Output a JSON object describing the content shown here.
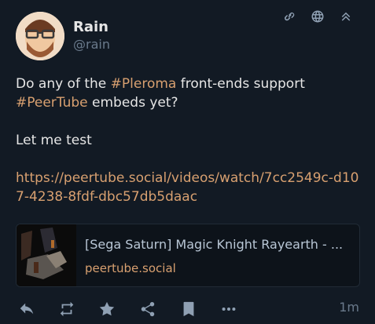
{
  "author": {
    "name": "Rain",
    "handle": "@rain"
  },
  "content": {
    "line1_prefix": "Do any of the ",
    "hashtag1": "#Pleroma",
    "line1_suffix": " front-ends support",
    "hashtag2": "#PeerTube",
    "line2_suffix": " embeds yet?",
    "paragraph2": "Let me test",
    "link": "https://peertube.social/videos/watch/7cc2549c-d107-4238-8fdf-dbc57db5daac"
  },
  "card": {
    "title": "[Sega Saturn] Magic Knight Rayearth - ...",
    "host": "peertube.social"
  },
  "timestamp": "1m",
  "colors": {
    "accent": "#d8a070",
    "background": "#121a24",
    "text": "#e6e6e6",
    "muted": "#6a7a8c"
  }
}
